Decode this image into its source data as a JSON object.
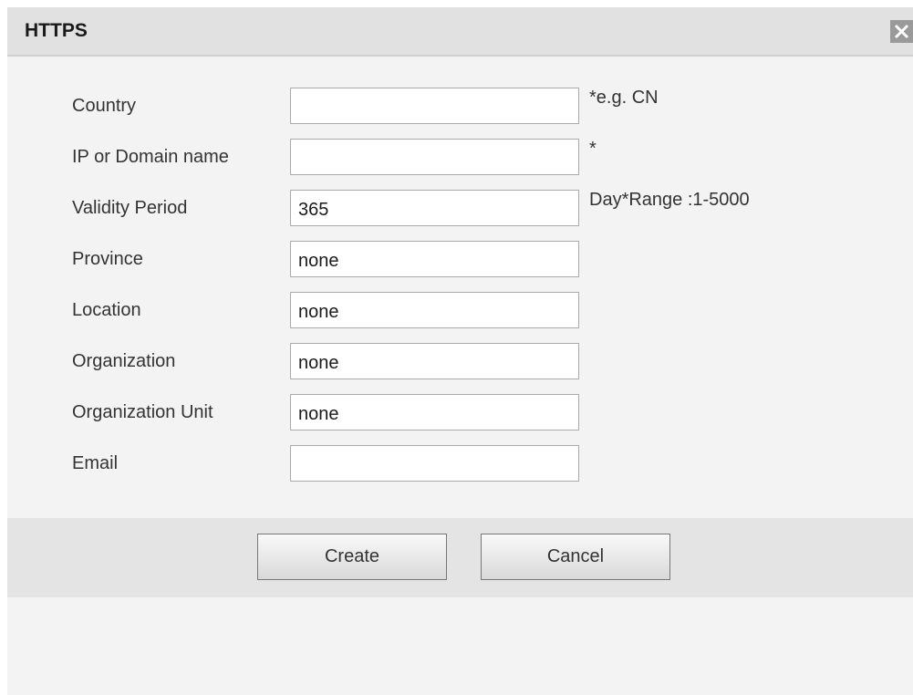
{
  "dialog": {
    "title": "HTTPS",
    "close_icon": "close-icon"
  },
  "form": {
    "country": {
      "label": "Country",
      "value": "",
      "hint": "*e.g. CN"
    },
    "ip_domain": {
      "label": "IP or Domain name",
      "value": "",
      "hint": "*"
    },
    "validity": {
      "label": "Validity Period",
      "value": "365",
      "hint": "Day*Range :1-5000"
    },
    "province": {
      "label": "Province",
      "value": "none"
    },
    "location": {
      "label": "Location",
      "value": "none"
    },
    "organization": {
      "label": "Organization",
      "value": "none"
    },
    "org_unit": {
      "label": "Organization Unit",
      "value": "none"
    },
    "email": {
      "label": "Email",
      "value": ""
    }
  },
  "buttons": {
    "create": "Create",
    "cancel": "Cancel"
  }
}
